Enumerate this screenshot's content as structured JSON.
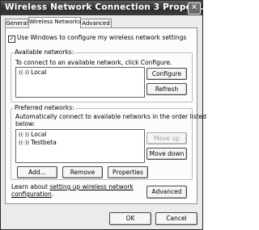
{
  "window": {
    "title": "Wireless Network Connection 3 Propert..."
  },
  "tabs": [
    {
      "label": "General",
      "active": false
    },
    {
      "label": "Wireless Networks",
      "active": true
    },
    {
      "label": "Advanced",
      "active": false
    }
  ],
  "use_windows_checkbox": {
    "label": "Use Windows to configure my wireless network settings",
    "checked": true,
    "mark": "✓"
  },
  "available": {
    "group_label": "Available networks:",
    "instruction": "To connect to an available network, click Configure.",
    "networks": [
      {
        "name": "Local",
        "icon": "wireless-network-icon"
      }
    ],
    "configure_label": "Configure",
    "refresh_label": "Refresh"
  },
  "preferred": {
    "group_label": "Preferred networks:",
    "instruction_line1": "Automatically connect to available networks in the order listed",
    "instruction_line2": "below:",
    "networks": [
      {
        "name": "Local",
        "icon": "wireless-network-icon"
      },
      {
        "name": "Testbeta",
        "icon": "wireless-network-icon"
      }
    ],
    "move_up_label": "Move up",
    "move_down_label": "Move down",
    "add_label": "Add...",
    "remove_label": "Remove",
    "properties_label": "Properties"
  },
  "learn": {
    "prefix": "Learn about ",
    "link_part1": "setting up wireless network",
    "link_part2": "configuration",
    "suffix": "."
  },
  "advanced_label": "Advanced",
  "footer": {
    "ok_label": "OK",
    "cancel_label": "Cancel"
  },
  "icons": {
    "close": "close-icon",
    "network_glyph": "⸮"
  }
}
